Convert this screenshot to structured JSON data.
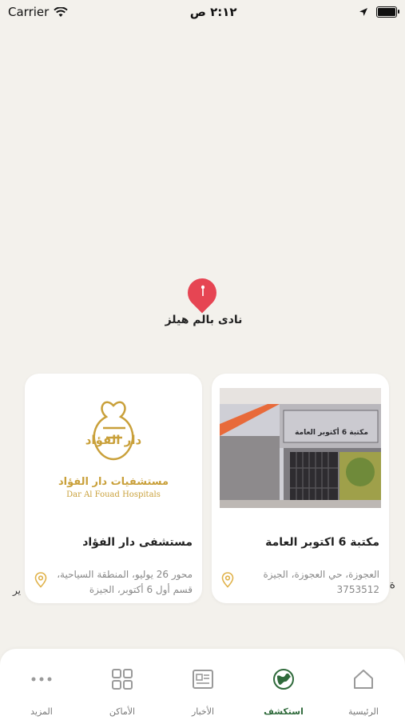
{
  "status": {
    "carrier": "Carrier",
    "time": "٢:١٢ ص"
  },
  "map": {
    "pin_label": "نادى بالم هيلز",
    "edge_left_text": "ير",
    "edge_right_text": "ة"
  },
  "cards": [
    {
      "title": "مستشفى دار الفؤاد",
      "address": "محور 26 يوليو، المنطقة السياحية، قسم أول 6 أكتوبر، الجيزة",
      "logo_arabic": "مستشفيات دار الفؤاد",
      "logo_english": "Dar Al Fouad Hospitals",
      "logo_mark": "دار الفؤاد"
    },
    {
      "title": "مكتبة 6 اكتوبر العامة",
      "address": "العجوزة، حي العجوزة، الجيزة 3753512",
      "sign_text": "مكتبة 6 أكتوبر العامة"
    }
  ],
  "tabs": [
    {
      "label": "الرئيسية",
      "icon": "home-icon"
    },
    {
      "label": "استكشف",
      "icon": "explore-icon",
      "active": true
    },
    {
      "label": "الأخبار",
      "icon": "news-icon"
    },
    {
      "label": "الأماكن",
      "icon": "places-icon"
    },
    {
      "label": "المزيد",
      "icon": "more-icon"
    }
  ],
  "colors": {
    "accent": "#2f6a3b",
    "pin": "#e64553",
    "gold": "#c9a03a"
  }
}
